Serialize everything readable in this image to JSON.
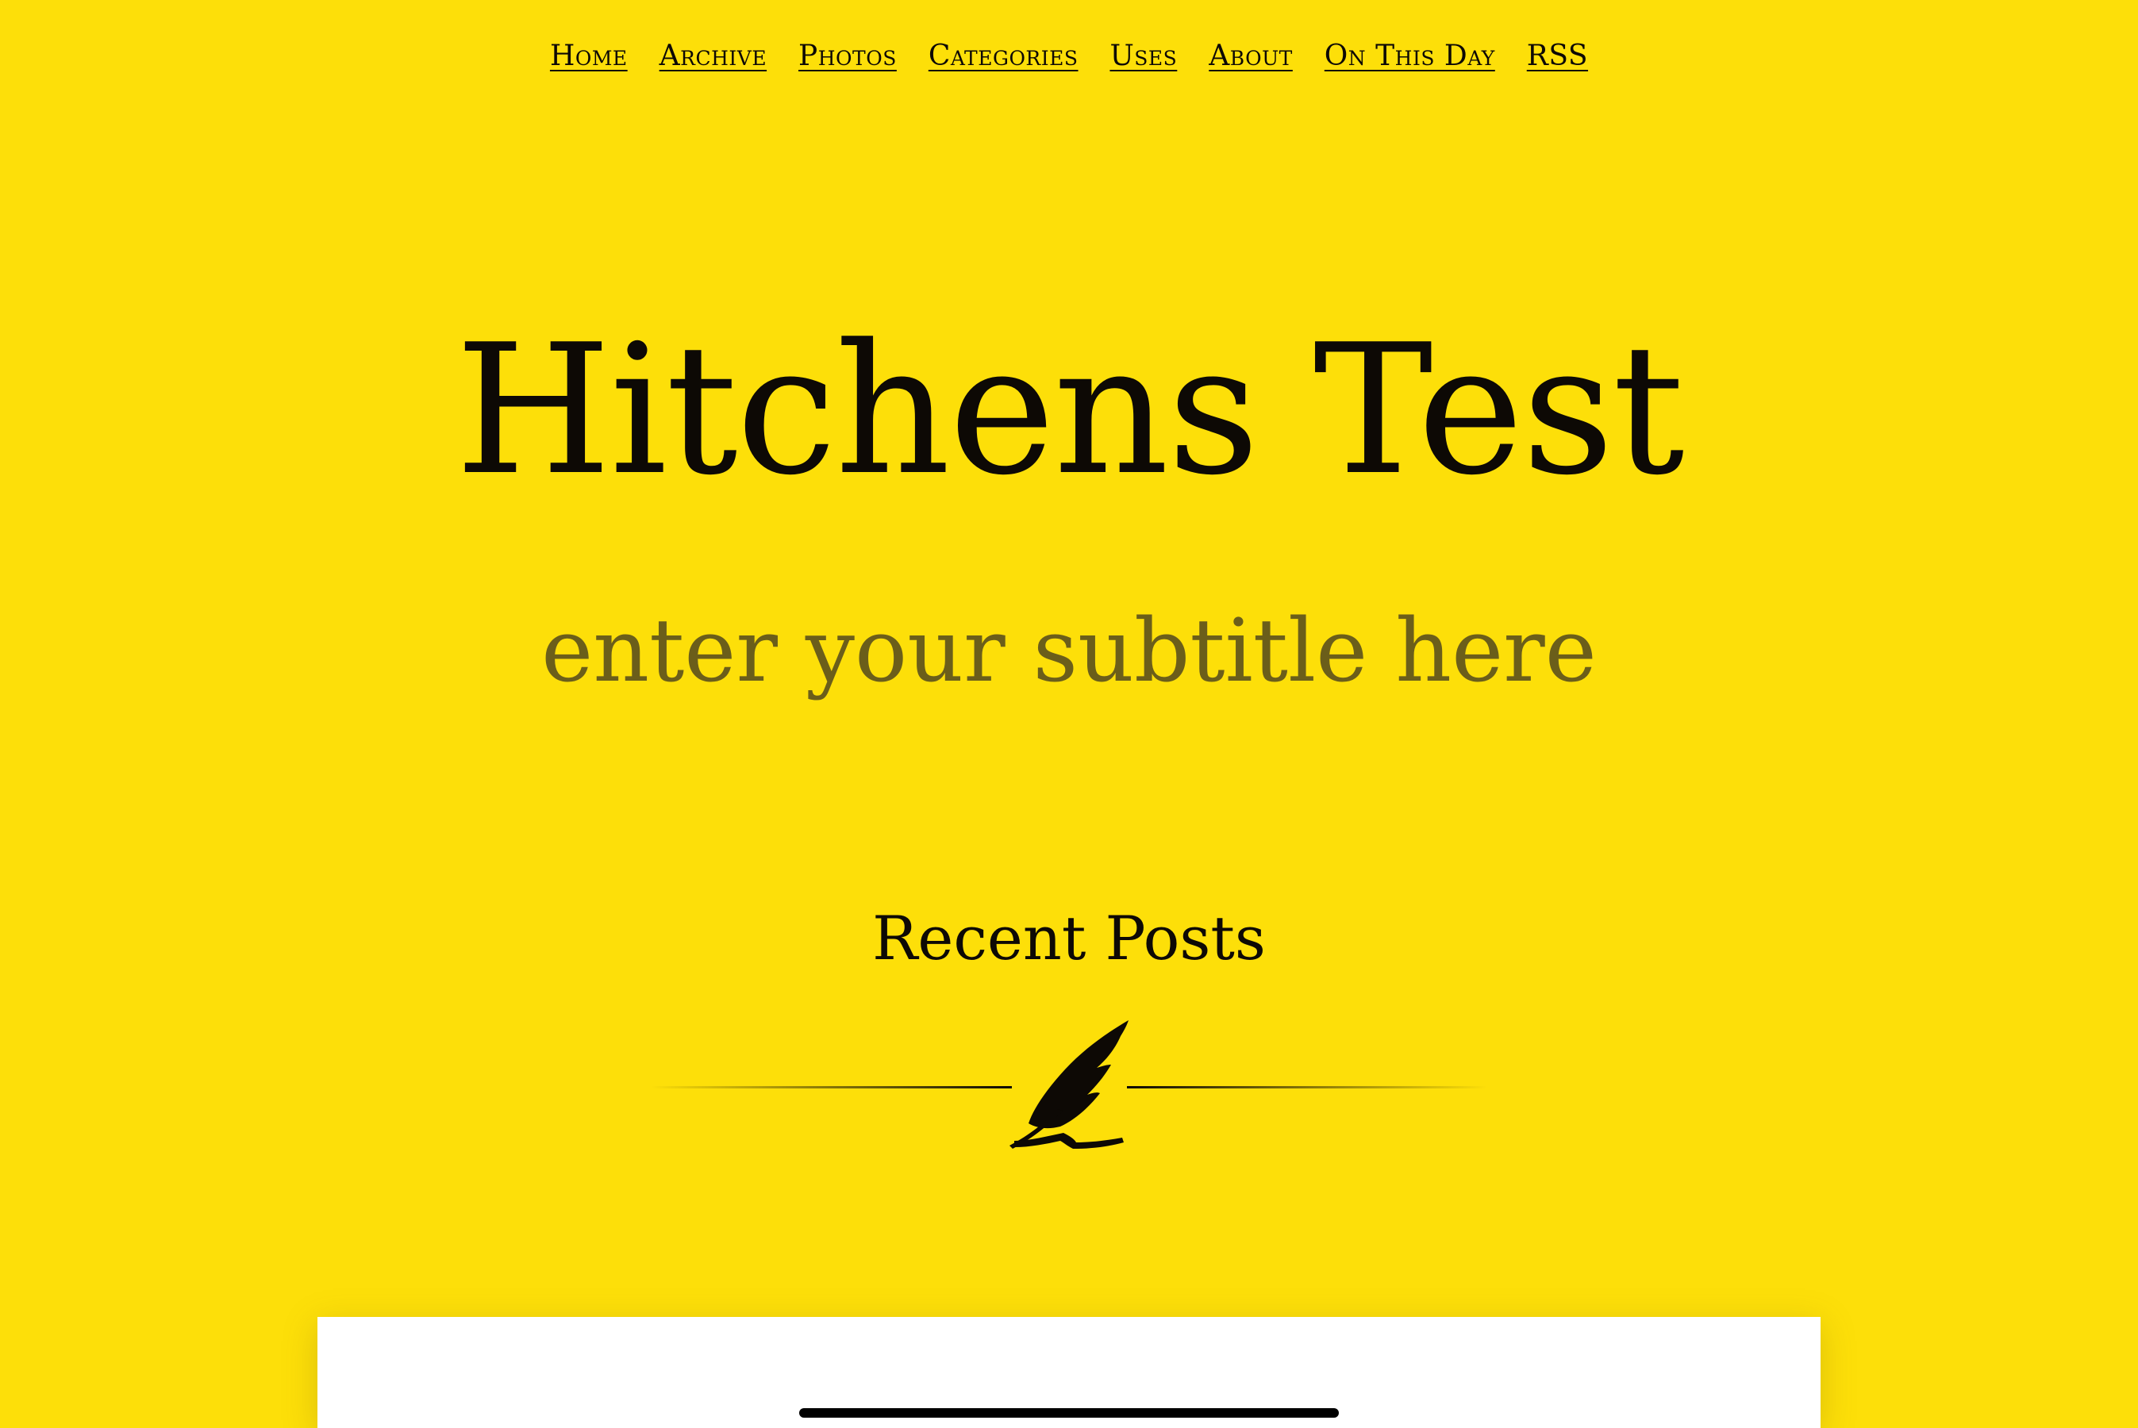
{
  "nav": {
    "items": [
      {
        "label": "Home"
      },
      {
        "label": "Archive"
      },
      {
        "label": "Photos"
      },
      {
        "label": "Categories"
      },
      {
        "label": "Uses"
      },
      {
        "label": "About"
      },
      {
        "label": "On This Day"
      },
      {
        "label": "RSS"
      }
    ]
  },
  "header": {
    "title": "Hitchens Test",
    "subtitle": "enter your subtitle here"
  },
  "main": {
    "section_heading": "Recent Posts",
    "divider_icon": "quill-pen-icon"
  },
  "colors": {
    "background": "#fddf09",
    "text": "#0d0905",
    "subtitle": "#6b5e1a",
    "card": "#ffffff"
  }
}
